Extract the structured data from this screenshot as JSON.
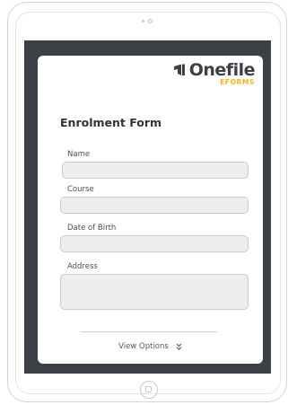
{
  "brand": {
    "name": "Onefile",
    "subtitle": "EFORMS",
    "accent_color": "#f4b41a",
    "dark_color": "#3b4147",
    "icon": "onefile-flag-icon"
  },
  "form": {
    "title": "Enrolment Form",
    "fields": [
      {
        "label": "Name",
        "value": "",
        "placeholder": ""
      },
      {
        "label": "Course",
        "value": "",
        "placeholder": ""
      },
      {
        "label": "Date of Birth",
        "value": "",
        "placeholder": ""
      },
      {
        "label": "Address",
        "value": "",
        "placeholder": ""
      }
    ]
  },
  "footer": {
    "view_options_label": "View Options",
    "view_options_icon": "double-chevron-down-icon"
  },
  "device": {
    "home_button_icon": "home-button-icon",
    "camera_icon": "camera-icon"
  }
}
